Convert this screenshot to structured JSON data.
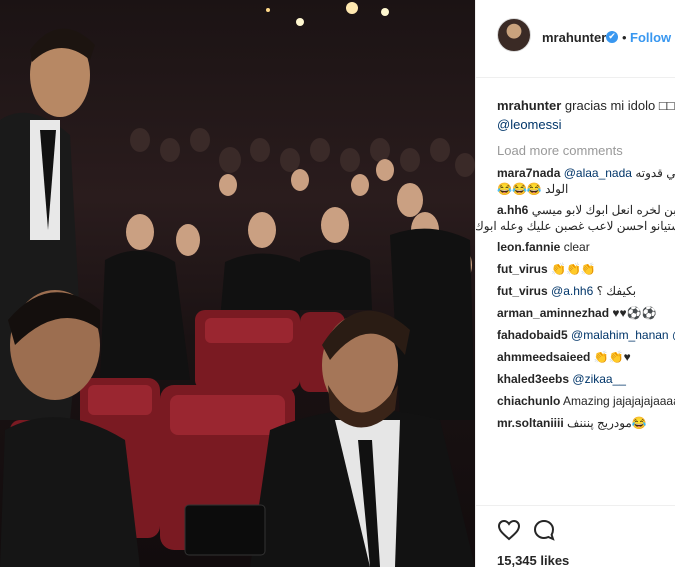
{
  "post": {
    "username": "mrahunter",
    "follow_label": "Follow",
    "separator": "•",
    "verified_mark": "✔",
    "caption_user": "mrahunter",
    "caption_text": "gracias mi idolo □□♥",
    "caption_mention": "@leomessi",
    "load_more": "Load more comments",
    "comments": [
      {
        "user": "mara7nada",
        "mention": "@alaa_nada",
        "text": "ميسي قدوته",
        "text2": "الولد 😂😂😂"
      },
      {
        "user": "a.hh6",
        "text": "وابوك ابن لخره انعل ابوك لابو ميسي",
        "text2": "رستيانو احسن لاعب غصبن عليك وعله ابوك"
      },
      {
        "user": "leon.fannie",
        "text": "clear"
      },
      {
        "user": "fut_virus",
        "text": "👏👏👏"
      },
      {
        "user": "fut_virus",
        "mention": "@a.hh6",
        "text": "بكيفك ؟"
      },
      {
        "user": "arman_aminnezhad",
        "text": "♥♥⚽⚽"
      },
      {
        "user": "fahadobaid5",
        "mention": "@malahim_hanan",
        "text": "@"
      },
      {
        "user": "ahmmeedsaieed",
        "text": "👏👏♥"
      },
      {
        "user": "khaled3eebs",
        "mention": "@zikaa__",
        "text": ""
      },
      {
        "user": "chiachunlo",
        "text": "Amazing jajajajajaaaa"
      },
      {
        "user": "mr.soltaniiii",
        "text": "مودريج پنننف😂"
      }
    ],
    "likes": "15,345 likes"
  },
  "icons": {
    "heart": "heart-icon",
    "comment": "comment-icon",
    "verified": "verified-badge-icon"
  },
  "colors": {
    "link": "#3897f0",
    "mention": "#003569",
    "muted": "#999999"
  }
}
